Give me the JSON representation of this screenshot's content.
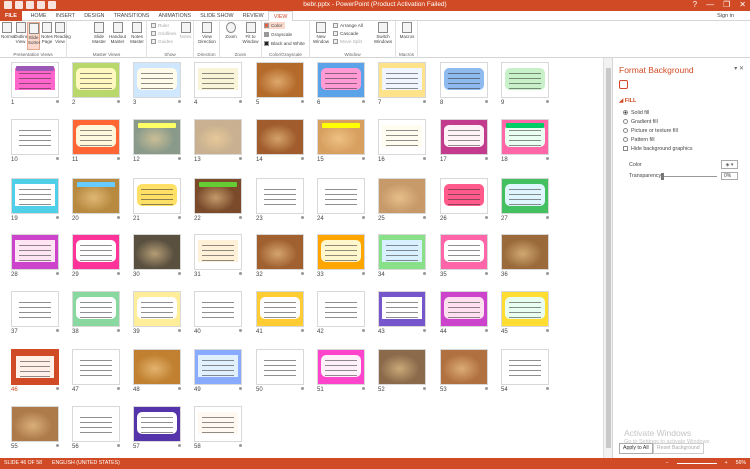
{
  "window": {
    "title": "bebr.pptx - PowerPoint (Product Activation Failed)",
    "user": "Sign in",
    "controls": [
      "?",
      "—",
      "❐",
      "✕"
    ]
  },
  "tabs": {
    "file": "FILE",
    "items": [
      "HOME",
      "INSERT",
      "DESIGN",
      "TRANSITIONS",
      "ANIMATIONS",
      "SLIDE SHOW",
      "REVIEW",
      "VIEW"
    ],
    "active_index": 7
  },
  "ribbon": {
    "presentation_views": {
      "label": "Presentation Views",
      "buttons": [
        "Normal",
        "Outline View",
        "Slide Sorter",
        "Notes Page",
        "Reading View"
      ]
    },
    "master_views": {
      "label": "Master Views",
      "buttons": [
        "Slide Master",
        "Handout Master",
        "Notes Master"
      ]
    },
    "show": {
      "label": "Show",
      "items": [
        "Ruler",
        "Gridlines",
        "Guides"
      ]
    },
    "notes": "Notes",
    "direction": {
      "label": "Direction",
      "button": "View Direction"
    },
    "zoom": {
      "label": "Zoom",
      "buttons": [
        "Zoom",
        "Fit to Window"
      ]
    },
    "color": {
      "label": "Color/Grayscale",
      "items": [
        "Color",
        "Grayscale",
        "Black and White"
      ]
    },
    "window": {
      "label": "Window",
      "new": "New Window",
      "items": [
        "Arrange All",
        "Cascade",
        "Move Split"
      ],
      "switch": "Switch Windows"
    },
    "macros": {
      "label": "Macros",
      "button": "Macros"
    }
  },
  "slides": [
    {
      "n": "1",
      "style": "text",
      "bg": "#ffffff",
      "band": "#ff66cc",
      "cap": "#9b59b6"
    },
    {
      "n": "2",
      "style": "text",
      "bg": "#b8d86b",
      "band": "#fff9c0",
      "cap": ""
    },
    {
      "n": "3",
      "style": "text",
      "bg": "#cfe8ff",
      "band": "#fffbea",
      "cap": ""
    },
    {
      "n": "4",
      "style": "text",
      "bg": "#ffffff",
      "band": "#f9f3d8",
      "cap": ""
    },
    {
      "n": "5",
      "style": "photo",
      "bg": "#b46a2b",
      "band": "",
      "cap": ""
    },
    {
      "n": "6",
      "style": "text",
      "bg": "#5aa3e8",
      "band": "#ff9ad5",
      "cap": ""
    },
    {
      "n": "7",
      "style": "text",
      "bg": "#ffe38a",
      "band": "#f0f6ff",
      "cap": ""
    },
    {
      "n": "8",
      "style": "text",
      "bg": "#ffffff",
      "band": "#8fbaf0",
      "cap": ""
    },
    {
      "n": "9",
      "style": "text",
      "bg": "#ffffff",
      "band": "#c9f1c9",
      "cap": ""
    },
    {
      "n": "10",
      "style": "text",
      "bg": "#ffffff",
      "band": "#ffffff",
      "cap": ""
    },
    {
      "n": "11",
      "style": "text",
      "bg": "#ff6633",
      "band": "#fff8dc",
      "cap": ""
    },
    {
      "n": "12",
      "style": "photo",
      "bg": "#8a9a8a",
      "band": "",
      "cap": "#ffff66"
    },
    {
      "n": "13",
      "style": "photo",
      "bg": "#c8b090",
      "band": "",
      "cap": ""
    },
    {
      "n": "14",
      "style": "photo",
      "bg": "#a05c2c",
      "band": "",
      "cap": ""
    },
    {
      "n": "15",
      "style": "photo",
      "bg": "#d8a060",
      "band": "",
      "cap": "#ffff00"
    },
    {
      "n": "16",
      "style": "text",
      "bg": "#ffffff",
      "band": "#fffdf0",
      "cap": ""
    },
    {
      "n": "17",
      "style": "text",
      "bg": "#c23b8c",
      "band": "#fff3f7",
      "cap": ""
    },
    {
      "n": "18",
      "style": "text",
      "bg": "#ff66a8",
      "band": "#e9fff0",
      "cap": "#00cc66"
    },
    {
      "n": "19",
      "style": "text",
      "bg": "#4fd0e8",
      "band": "#ffffff",
      "cap": ""
    },
    {
      "n": "20",
      "style": "photo",
      "bg": "#b88a40",
      "band": "",
      "cap": "#66ccff"
    },
    {
      "n": "21",
      "style": "text",
      "bg": "#ffffff",
      "band": "#ffe066",
      "cap": ""
    },
    {
      "n": "22",
      "style": "photo",
      "bg": "#7a4a2a",
      "band": "",
      "cap": "#66cc33"
    },
    {
      "n": "23",
      "style": "text",
      "bg": "#ffffff",
      "band": "#ffffff",
      "cap": ""
    },
    {
      "n": "24",
      "style": "text",
      "bg": "#ffffff",
      "band": "#ffffff",
      "cap": ""
    },
    {
      "n": "25",
      "style": "photo",
      "bg": "#c89a6a",
      "band": "",
      "cap": ""
    },
    {
      "n": "26",
      "style": "text",
      "bg": "#ffffff",
      "band": "#ff5a8a",
      "cap": ""
    },
    {
      "n": "27",
      "style": "text",
      "bg": "#44c060",
      "band": "#dff6ff",
      "cap": ""
    },
    {
      "n": "28",
      "style": "text",
      "bg": "#cc44cc",
      "band": "#ffe4f4",
      "cap": ""
    },
    {
      "n": "29",
      "style": "text",
      "bg": "#ff3399",
      "band": "#ffffff",
      "cap": ""
    },
    {
      "n": "30",
      "style": "photo",
      "bg": "#5a5040",
      "band": "",
      "cap": ""
    },
    {
      "n": "31",
      "style": "text",
      "bg": "#ffffff",
      "band": "#fff0d8",
      "cap": ""
    },
    {
      "n": "32",
      "style": "photo",
      "bg": "#a06030",
      "band": "",
      "cap": ""
    },
    {
      "n": "33",
      "style": "text",
      "bg": "#ffa500",
      "band": "#fff6cc",
      "cap": ""
    },
    {
      "n": "34",
      "style": "text",
      "bg": "#88e088",
      "band": "#d8f0ff",
      "cap": ""
    },
    {
      "n": "35",
      "style": "text",
      "bg": "#ff66aa",
      "band": "#ffffff",
      "cap": ""
    },
    {
      "n": "36",
      "style": "photo",
      "bg": "#9a6a3a",
      "band": "",
      "cap": ""
    },
    {
      "n": "37",
      "style": "text",
      "bg": "#ffffff",
      "band": "#ffffff",
      "cap": ""
    },
    {
      "n": "38",
      "style": "text",
      "bg": "#88d8a0",
      "band": "#ffffff",
      "cap": ""
    },
    {
      "n": "39",
      "style": "text",
      "bg": "#ffee99",
      "band": "#ffffff",
      "cap": ""
    },
    {
      "n": "40",
      "style": "text",
      "bg": "#ffffff",
      "band": "#ffffff",
      "cap": ""
    },
    {
      "n": "41",
      "style": "text",
      "bg": "#ffcc33",
      "band": "#ffffff",
      "cap": ""
    },
    {
      "n": "42",
      "style": "text",
      "bg": "#ffffff",
      "band": "#ffffff",
      "cap": ""
    },
    {
      "n": "43",
      "style": "text",
      "bg": "#7755cc",
      "band": "#ffffff",
      "cap": ""
    },
    {
      "n": "44",
      "style": "text",
      "bg": "#cc44cc",
      "band": "#ffdff0",
      "cap": ""
    },
    {
      "n": "45",
      "style": "text",
      "bg": "#ffdd33",
      "band": "#e8fff0",
      "cap": ""
    },
    {
      "n": "46",
      "style": "text",
      "bg": "#d04a25",
      "band": "#fff0e8",
      "cap": ""
    },
    {
      "n": "47",
      "style": "text",
      "bg": "#ffffff",
      "band": "#ffffff",
      "cap": ""
    },
    {
      "n": "48",
      "style": "photo",
      "bg": "#c08030",
      "band": "",
      "cap": ""
    },
    {
      "n": "49",
      "style": "text",
      "bg": "#88aaff",
      "band": "#e0f0ff",
      "cap": ""
    },
    {
      "n": "50",
      "style": "text",
      "bg": "#ffffff",
      "band": "#ffffff",
      "cap": ""
    },
    {
      "n": "51",
      "style": "text",
      "bg": "#ff44cc",
      "band": "#fff0fa",
      "cap": ""
    },
    {
      "n": "52",
      "style": "photo",
      "bg": "#8a6a4a",
      "band": "",
      "cap": ""
    },
    {
      "n": "53",
      "style": "photo",
      "bg": "#b07040",
      "band": "",
      "cap": ""
    },
    {
      "n": "54",
      "style": "text",
      "bg": "#ffffff",
      "band": "#ffffff",
      "cap": ""
    },
    {
      "n": "55",
      "style": "photo",
      "bg": "#ad7a4a",
      "band": "",
      "cap": ""
    },
    {
      "n": "56",
      "style": "text",
      "bg": "#ffffff",
      "band": "#ffffff",
      "cap": ""
    },
    {
      "n": "57",
      "style": "text",
      "bg": "#5533aa",
      "band": "#ffffff",
      "cap": ""
    },
    {
      "n": "58",
      "style": "text",
      "bg": "#ffffff",
      "band": "#fff8f0",
      "cap": ""
    }
  ],
  "pane": {
    "title": "Format Background",
    "section": "FILL",
    "fill_options": [
      "Solid fill",
      "Gradient fill",
      "Picture or texture fill",
      "Pattern fill"
    ],
    "hide_graphics": "Hide background graphics",
    "color_label": "Color",
    "transparency_label": "Transparency",
    "transparency_value": "0%",
    "apply_all": "Apply to All",
    "reset": "Reset Background"
  },
  "watermark": {
    "line1": "Activate Windows",
    "line2": "Go to Settings to activate Windows."
  },
  "status": {
    "slide": "SLIDE 46 OF 58",
    "language": "ENGLISH (UNITED STATES)",
    "zoom": "56%"
  }
}
